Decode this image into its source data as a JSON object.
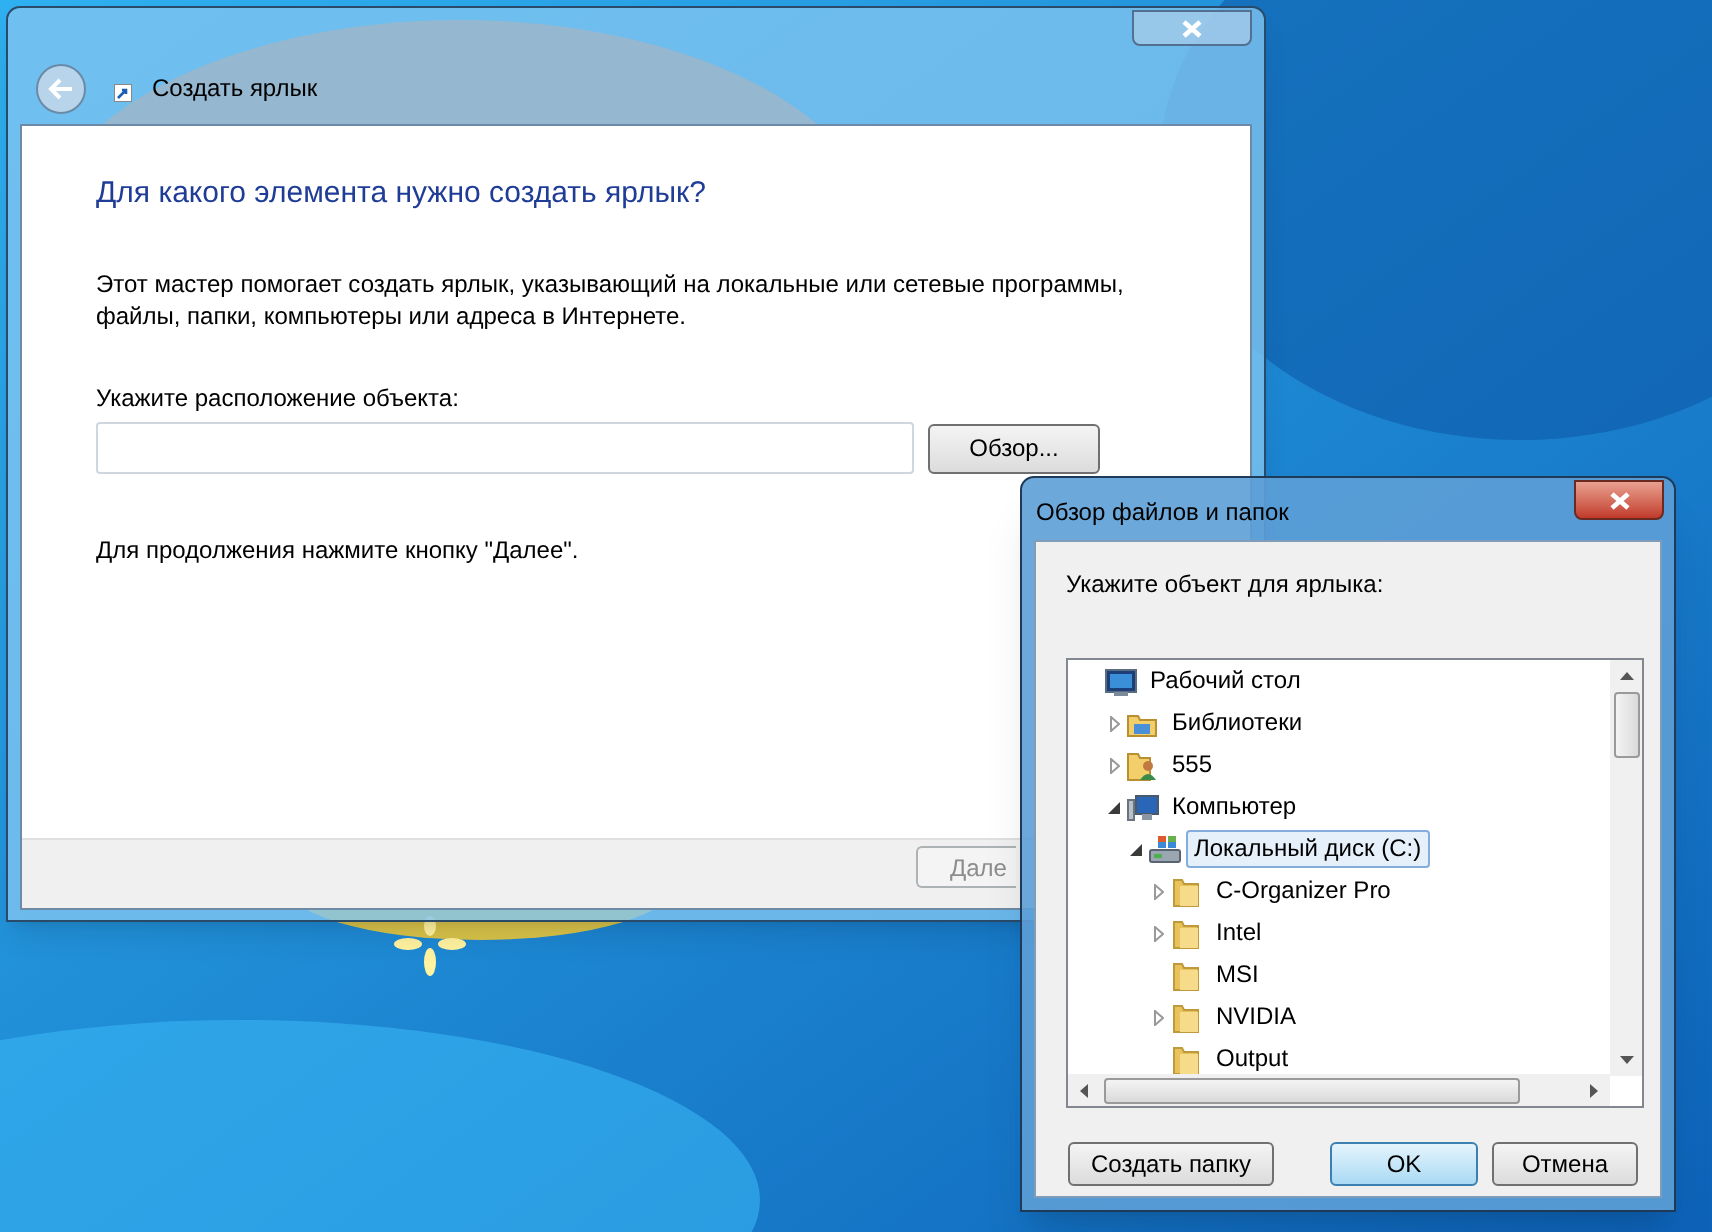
{
  "main_window": {
    "title": "Создать ярлык",
    "heading": "Для какого элемента нужно создать ярлык?",
    "description": "Этот мастер помогает создать ярлык, указывающий на локальные или сетевые программы, файлы, папки, компьютеры или адреса в Интернете.",
    "location_label": "Укажите расположение объекта:",
    "browse_button": "Обзор...",
    "hint": "Для продолжения нажмите кнопку \"Далее\".",
    "next_button": {
      "label": "Дале",
      "disabled": true
    }
  },
  "browse_dialog": {
    "title": "Обзор файлов и папок",
    "prompt": "Укажите объект для ярлыка:",
    "tree": [
      {
        "label": "Рабочий стол",
        "kind": "desktop",
        "expandable": false,
        "selected": false,
        "children": [
          {
            "label": "Библиотеки",
            "kind": "library",
            "expandable": true,
            "expanded": false,
            "selected": false
          },
          {
            "label": "555",
            "kind": "user_folder",
            "expandable": true,
            "expanded": false,
            "selected": false
          },
          {
            "label": "Компьютер",
            "kind": "computer",
            "expandable": true,
            "expanded": true,
            "selected": false,
            "children": [
              {
                "label": "Локальный диск (C:)",
                "kind": "drive",
                "expandable": true,
                "expanded": true,
                "selected": true,
                "children": [
                  {
                    "label": "C-Organizer Pro",
                    "kind": "folder",
                    "expandable": true,
                    "expanded": false,
                    "selected": false
                  },
                  {
                    "label": "Intel",
                    "kind": "folder",
                    "expandable": true,
                    "expanded": false,
                    "selected": false
                  },
                  {
                    "label": "MSI",
                    "kind": "folder",
                    "expandable": false,
                    "selected": false
                  },
                  {
                    "label": "NVIDIA",
                    "kind": "folder",
                    "expandable": true,
                    "expanded": false,
                    "selected": false
                  },
                  {
                    "label": "Output",
                    "kind": "folder",
                    "expandable": false,
                    "selected": false
                  }
                ]
              }
            ]
          }
        ]
      }
    ],
    "buttons": [
      {
        "label": "Создать папку",
        "default": false
      },
      {
        "label": "OK",
        "default": true
      },
      {
        "label": "Отмена",
        "default": false
      }
    ]
  }
}
